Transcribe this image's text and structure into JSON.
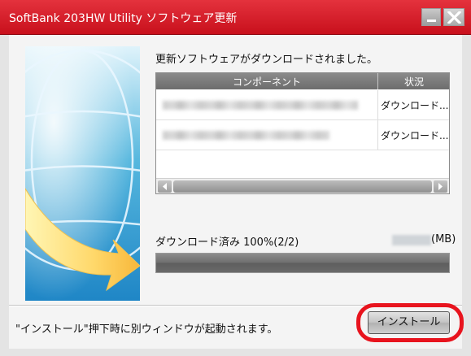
{
  "window": {
    "title": "SoftBank 203HW Utility ソフトウェア更新",
    "accent_color": "#d01a24",
    "highlight_color": "#e8141e"
  },
  "main": {
    "headline": "更新ソフトウェアがダウンロードされました。",
    "table": {
      "columns": [
        "コンポーネント",
        "状況"
      ],
      "rows": [
        {
          "component": "",
          "status": "ダウンロード..."
        },
        {
          "component": "",
          "status": "ダウンロード..."
        }
      ]
    },
    "download": {
      "label": "ダウンロード済み 100%(2/2)",
      "progress_percent": 100,
      "size_unit": "(MB)"
    }
  },
  "footer": {
    "note": "\"インストール\"押下時に別ウィンドウが起動されます。",
    "install_label": "インストール"
  },
  "icons": [
    "minimize-icon",
    "close-icon",
    "globe-arrow-illustration",
    "scroll-left-icon",
    "scroll-right-icon"
  ]
}
